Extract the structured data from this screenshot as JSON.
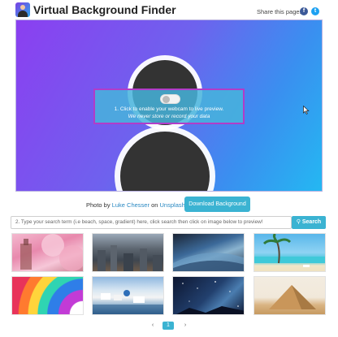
{
  "header": {
    "title": "Virtual Background Finder",
    "share_label": "Share this page:",
    "social": [
      {
        "icon": "facebook-icon",
        "glyph": "f"
      },
      {
        "icon": "twitter-icon",
        "glyph": "t"
      }
    ]
  },
  "preview": {
    "toggle_state": "off",
    "enable_text": "1. Click to enable your webcam to live preview.",
    "privacy_text": "We never store or record your data",
    "colors": {
      "gradient_start": "#8b3ff0",
      "gradient_end": "#24b8f2",
      "panel_border": "#b23cc8",
      "silhouette": "#333333"
    }
  },
  "credit": {
    "photo_by": "Photo by",
    "author": "Luke Chesser",
    "on": "on",
    "source": "Unsplash",
    "download_label": "Download Background"
  },
  "search": {
    "placeholder": "2. Type your search term (i.e beach, space, gradient) here, click search then click on image below to preview!",
    "button_label": "Search",
    "accent": "#3bb3d2"
  },
  "thumbnails": [
    {
      "name": "cherry-blossom"
    },
    {
      "name": "city-aerial"
    },
    {
      "name": "earth-from-space"
    },
    {
      "name": "tropical-beach"
    },
    {
      "name": "rainbow-arcs"
    },
    {
      "name": "santorini-coast"
    },
    {
      "name": "starry-night"
    },
    {
      "name": "desert-pyramid"
    }
  ],
  "pagination": {
    "prev": "‹",
    "current": "1",
    "next": "›"
  }
}
